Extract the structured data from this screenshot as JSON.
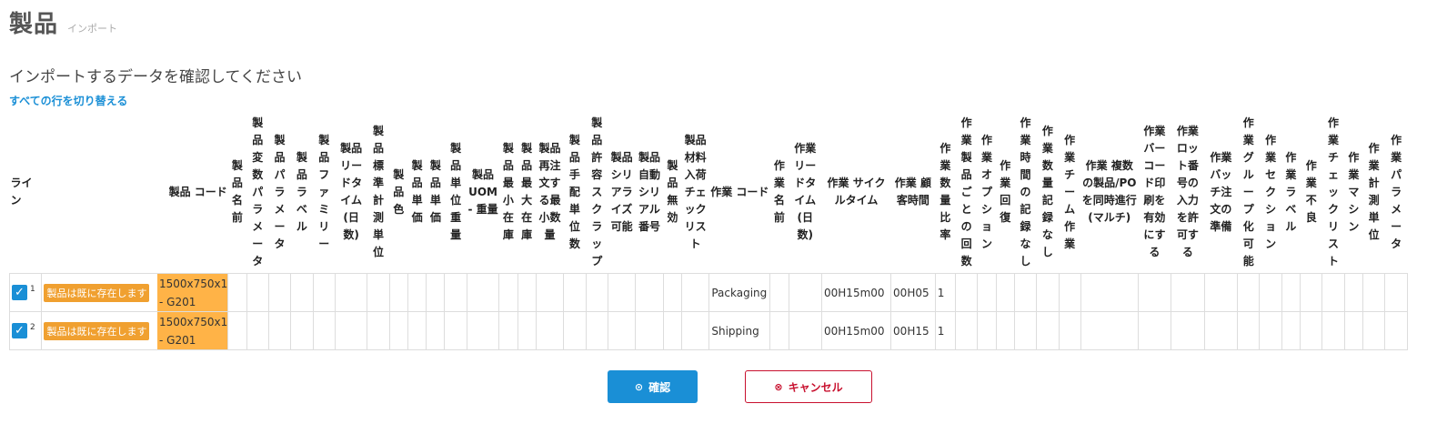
{
  "header": {
    "title": "製品",
    "subtitle": "インポート"
  },
  "confirm_text": "インポートするデータを確認してください",
  "toggle_all": "すべての行を切り替える",
  "columns": [
    "ライン",
    "製品 コード",
    "製品名前",
    "製品変数パラメータ",
    "製品パラメータ",
    "製品ラベル",
    "製品ファミリー",
    "製品リードタイム(日数)",
    "製品標準計測単位",
    "製品色",
    "製品単価",
    "製品単価",
    "製品単位重量",
    "製品UOM - 重量",
    "製品最小在庫",
    "製品最大在庫",
    "製品再注文する最小数量",
    "製品手配単位数",
    "製品許容スクラップ",
    "製品シリアライズ可能",
    "製品自動シリアル番号",
    "製品無効",
    "製品材料入荷チェックリスト",
    "作業 コード",
    "作業名前",
    "作業リードタイム(日数)",
    "作業 サイクルタイム",
    "作業 顧客時間",
    "作業数量比率",
    "作業製品ごとの回数",
    "作業オプション",
    "作業回復",
    "作業時間の記録なし",
    "作業数量記録なし",
    "作業チーム作業",
    "作業 複数の製品/POを同時進行(マルチ)",
    "作業バーコード印刷を有効にする",
    "作業ロット番号の入力を許可する",
    "作業バッチ注文の準備",
    "作業グループ化可能",
    "作業セクション",
    "作業ラベル",
    "作業不良",
    "作業チェックリスト",
    "作業マシン",
    "作業計測単位",
    "作業パラメータ"
  ],
  "rows": [
    {
      "line": "1",
      "badge": "製品は既に存在します",
      "code": "1500x750x1 - G201",
      "op_code": "Packaging",
      "cycle_time": "00H15m00",
      "customer_time": "00H05",
      "qty_ratio": "1"
    },
    {
      "line": "2",
      "badge": "製品は既に存在します",
      "code": "1500x750x1 - G201",
      "op_code": "Shipping",
      "cycle_time": "00H15m00",
      "customer_time": "00H15",
      "qty_ratio": "1"
    }
  ],
  "buttons": {
    "confirm": "確認",
    "cancel": "キャンセル"
  },
  "icons": {
    "checkbox": "check-icon",
    "confirm": "circle-check-icon",
    "cancel": "circle-x-icon"
  },
  "colors": {
    "accent": "#1a8fd6",
    "badge": "#f0a030",
    "code_bg": "#ffb347",
    "cancel": "#c8102e"
  }
}
